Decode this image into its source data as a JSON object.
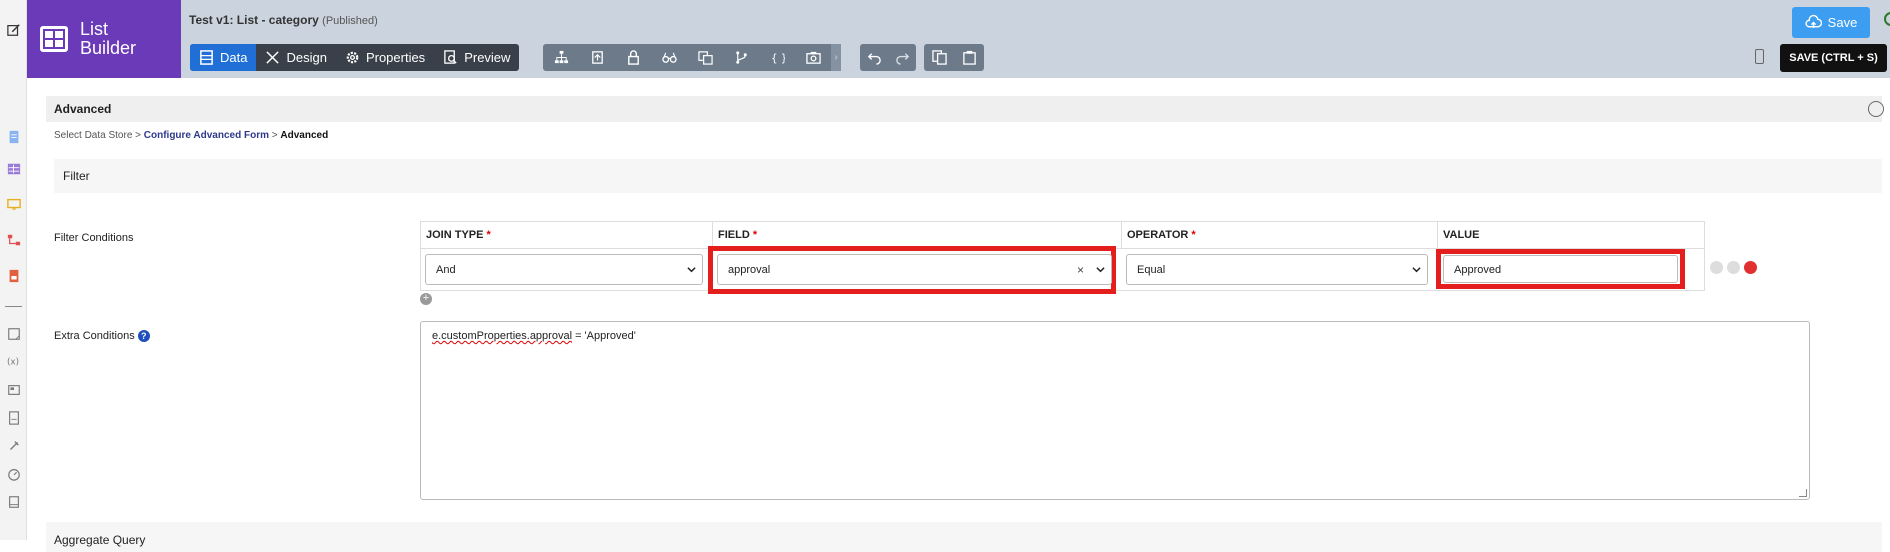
{
  "app": {
    "brand": "List Builder",
    "title": "Test v1: List - category",
    "status": "(Published)"
  },
  "nav": {
    "tabs": [
      {
        "label": "Data",
        "icon": "table-icon",
        "active": true
      },
      {
        "label": "Design",
        "icon": "design-icon"
      },
      {
        "label": "Properties",
        "icon": "gear-icon"
      },
      {
        "label": "Preview",
        "icon": "preview-icon"
      }
    ]
  },
  "toolbar": {
    "save_label": "Save",
    "save_shortcut_label": "SAVE (CTRL + S)"
  },
  "section": {
    "title": "Advanced",
    "breadcrumb": [
      {
        "label": "Select Data Store"
      },
      {
        "label": "Configure Advanced Form"
      },
      {
        "label": "Advanced"
      }
    ],
    "separator": ">",
    "filter_title": "Filter",
    "aggregate_title": "Aggregate Query"
  },
  "filter": {
    "conditions_label": "Filter Conditions",
    "columns": [
      {
        "label": "JOIN TYPE",
        "required": "*"
      },
      {
        "label": "FIELD",
        "required": "*"
      },
      {
        "label": "OPERATOR",
        "required": "*"
      },
      {
        "label": "VALUE",
        "required": ""
      }
    ],
    "row": {
      "join_type": "And",
      "field": "approval",
      "field_clear": "×",
      "operator": "Equal",
      "value": "Approved"
    },
    "add_row": "+",
    "extra_label": "Extra Conditions",
    "help": "?",
    "extra_value_prefix": "e.customProperties.approval",
    "extra_value_suffix": " = 'Approved'"
  },
  "colors": {
    "brand": "#6a3ab8",
    "accent": "#1f6fd6",
    "highlight": "#e41d1d",
    "save": "#3d9df0"
  }
}
